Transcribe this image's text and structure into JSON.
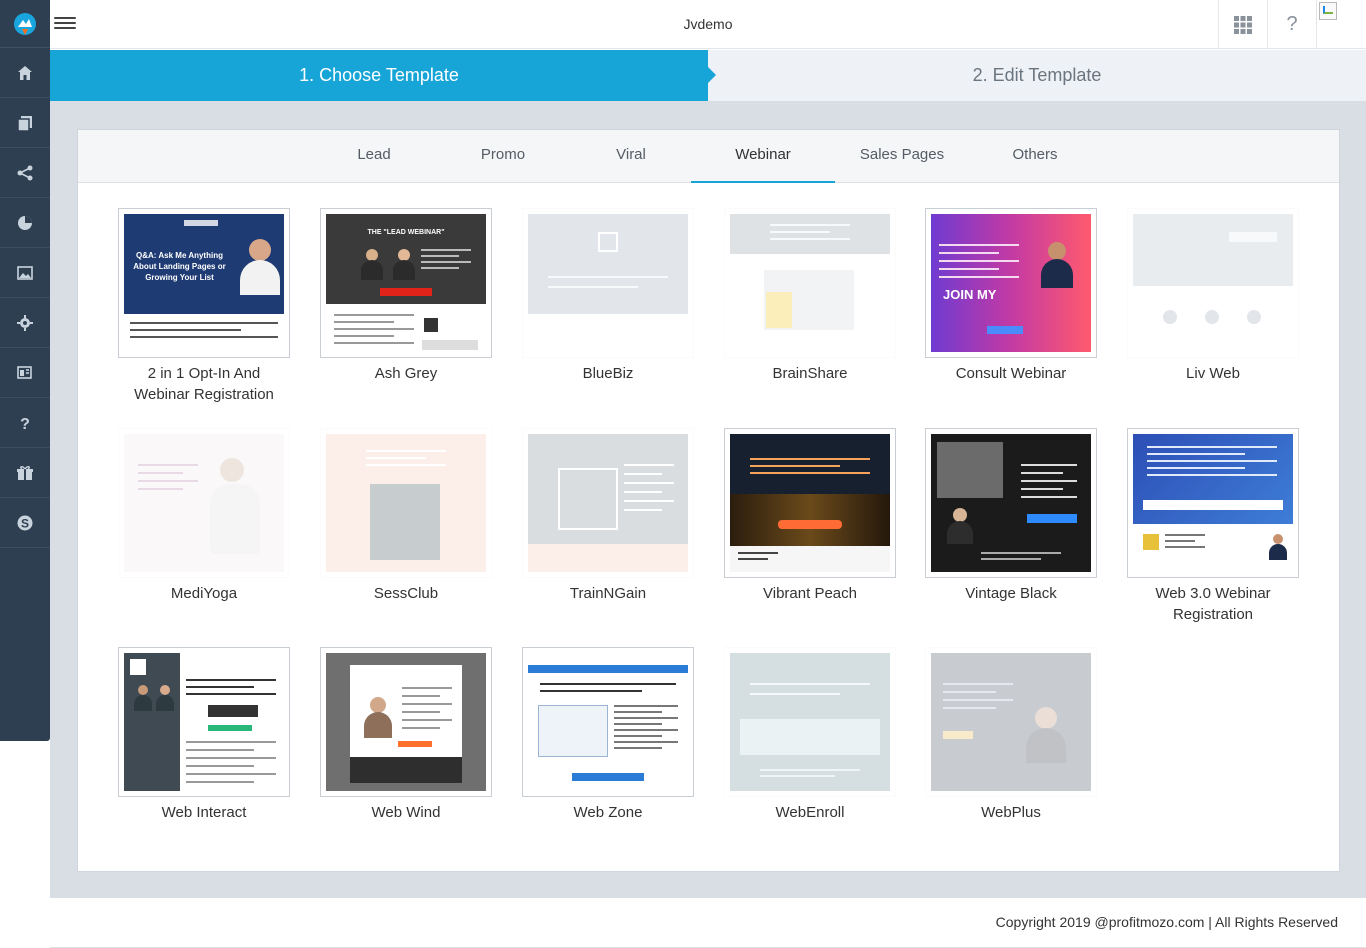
{
  "app": {
    "title": "Jvdemo"
  },
  "sidebar": {
    "items": [
      {
        "icon": "home-icon"
      },
      {
        "icon": "pages-icon"
      },
      {
        "icon": "share-icon"
      },
      {
        "icon": "pie-chart-icon"
      },
      {
        "icon": "image-icon"
      },
      {
        "icon": "gear-icon"
      },
      {
        "icon": "template-icon"
      },
      {
        "icon": "help-icon"
      },
      {
        "icon": "gift-icon"
      },
      {
        "icon": "skype-icon"
      }
    ]
  },
  "topbar": {
    "help": "?"
  },
  "steps": [
    {
      "label": "1. Choose Template",
      "active": true
    },
    {
      "label": "2. Edit Template",
      "active": false
    }
  ],
  "tabs": [
    {
      "label": "Lead"
    },
    {
      "label": "Promo"
    },
    {
      "label": "Viral"
    },
    {
      "label": "Webinar",
      "active": true
    },
    {
      "label": "Sales Pages"
    },
    {
      "label": "Others"
    }
  ],
  "templates": [
    {
      "name": "2 in 1 Opt-In And Webinar Registration",
      "faded": false
    },
    {
      "name": "Ash Grey",
      "faded": false
    },
    {
      "name": "BlueBiz",
      "faded": true
    },
    {
      "name": "BrainShare",
      "faded": true
    },
    {
      "name": "Consult Webinar",
      "faded": false
    },
    {
      "name": "Liv Web",
      "faded": true
    },
    {
      "name": "MediYoga",
      "faded": true
    },
    {
      "name": "SessClub",
      "faded": true
    },
    {
      "name": "TrainNGain",
      "faded": true
    },
    {
      "name": "Vibrant Peach",
      "faded": false
    },
    {
      "name": "Vintage Black",
      "faded": false
    },
    {
      "name": "Web 3.0 Webinar Registration",
      "faded": false
    },
    {
      "name": "Web Interact",
      "faded": false
    },
    {
      "name": "Web Wind",
      "faded": false
    },
    {
      "name": "Web Zone",
      "faded": false
    },
    {
      "name": "WebEnroll",
      "faded": true
    },
    {
      "name": "WebPlus",
      "faded": true
    }
  ],
  "thumb_text": {
    "t0": "Q&A: Ask Me Anything About Landing Pages or Growing Your List",
    "t1": "THE \"LEAD WEBINAR\"",
    "t4": "JOIN MY"
  },
  "footer": {
    "text": "Copyright 2019 @profitmozo.com | All Rights Reserved"
  },
  "colors": {
    "accent": "#17a5d8",
    "sidebar": "#2e3f51",
    "content_bg": "#d9dee4"
  }
}
